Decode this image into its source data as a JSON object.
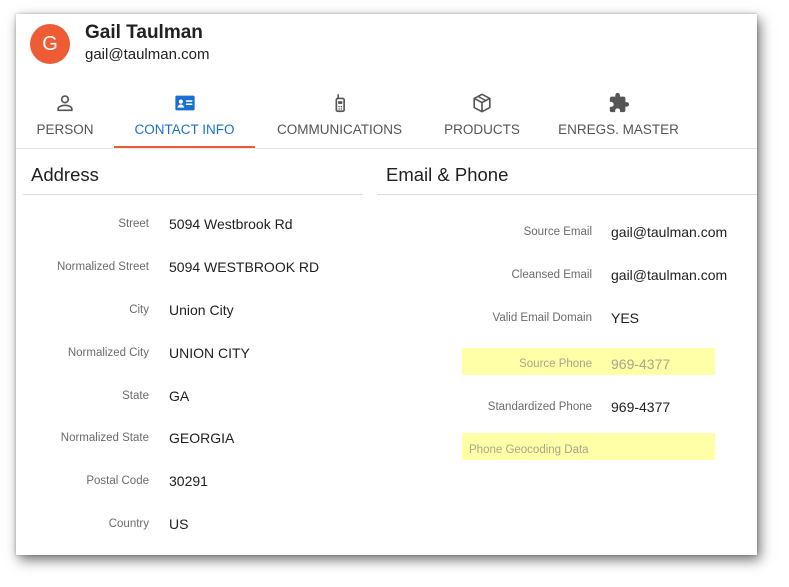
{
  "colors": {
    "accent": "#ee5c36",
    "active_tab": "#1a6fd4",
    "highlight": "#ffffa8"
  },
  "user": {
    "initial": "G",
    "name": "Gail Taulman",
    "email": "gail@taulman.com"
  },
  "tabs": [
    {
      "label": "PERSON",
      "icon": "person-icon",
      "active": false
    },
    {
      "label": "CONTACT INFO",
      "icon": "contact-card-icon",
      "active": true
    },
    {
      "label": "COMMUNICATIONS",
      "icon": "phone-icon",
      "active": false
    },
    {
      "label": "PRODUCTS",
      "icon": "box-icon",
      "active": false
    },
    {
      "label": "ENREGS. MASTER",
      "icon": "puzzle-icon",
      "active": false
    }
  ],
  "address": {
    "title": "Address",
    "fields": [
      {
        "label": "Street",
        "value": "5094 Westbrook Rd"
      },
      {
        "label": "Normalized Street",
        "value": "5094 WESTBROOK RD"
      },
      {
        "label": "City",
        "value": "Union City"
      },
      {
        "label": "Normalized City",
        "value": "UNION CITY"
      },
      {
        "label": "State",
        "value": "GA"
      },
      {
        "label": "Normalized State",
        "value": "GEORGIA"
      },
      {
        "label": "Postal Code",
        "value": "30291"
      },
      {
        "label": "Country",
        "value": "US"
      }
    ]
  },
  "email_phone": {
    "title": "Email & Phone",
    "fields": [
      {
        "label": "Source Email",
        "value": "gail@taulman.com",
        "highlighted": false
      },
      {
        "label": "Cleansed Email",
        "value": "gail@taulman.com",
        "highlighted": false
      },
      {
        "label": "Valid Email Domain",
        "value": "YES",
        "highlighted": false
      },
      {
        "label": "Source Phone",
        "value": "969-4377",
        "highlighted": true
      },
      {
        "label": "Standardized Phone",
        "value": "969-4377",
        "highlighted": false
      },
      {
        "label": "Phone Geocoding Data",
        "value": "",
        "highlighted": true
      }
    ]
  }
}
